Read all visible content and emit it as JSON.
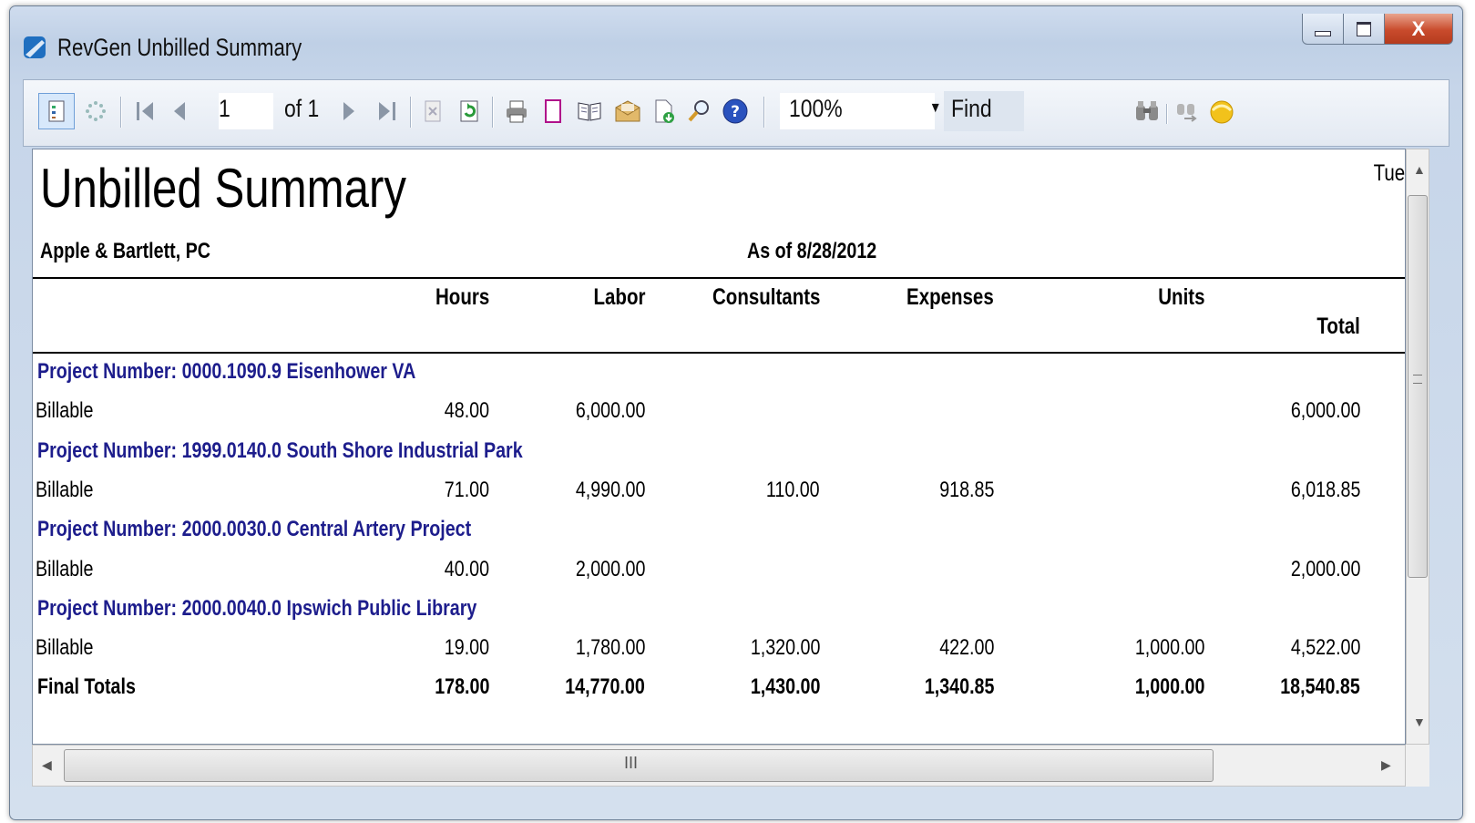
{
  "window": {
    "title": "RevGen Unbilled Summary",
    "controls": {
      "minimize": "minimize",
      "maximize": "maximize",
      "close": "X"
    }
  },
  "toolbar": {
    "page_current": "1",
    "page_of": "of 1",
    "zoom": "100%",
    "find_label": "Find",
    "icons": [
      "document-map-icon",
      "thumbnails-icon",
      "first-page-icon",
      "previous-page-icon",
      "next-page-icon",
      "last-page-icon",
      "stop-icon",
      "refresh-icon",
      "print-icon",
      "page-setup-icon",
      "book-icon",
      "export-icon",
      "save-icon",
      "zoom-icon",
      "help-icon",
      "find-icon",
      "find-next-icon",
      "highlight-icon"
    ]
  },
  "report": {
    "title": "Unbilled Summary",
    "corner_text": "Tue",
    "company": "Apple & Bartlett, PC",
    "as_of": "As of 8/28/2012",
    "columns": [
      "Hours",
      "Labor",
      "Consultants",
      "Expenses",
      "Units",
      "Total"
    ],
    "projects": [
      {
        "header": "Project Number: 0000.1090.9 Eisenhower VA",
        "row_label": "Billable",
        "hours": "48.00",
        "labor": "6,000.00",
        "consultants": "",
        "expenses": "",
        "units": "",
        "total": "6,000.00"
      },
      {
        "header": "Project Number: 1999.0140.0 South Shore Industrial Park",
        "row_label": "Billable",
        "hours": "71.00",
        "labor": "4,990.00",
        "consultants": "110.00",
        "expenses": "918.85",
        "units": "",
        "total": "6,018.85"
      },
      {
        "header": "Project Number: 2000.0030.0 Central Artery Project",
        "row_label": "Billable",
        "hours": "40.00",
        "labor": "2,000.00",
        "consultants": "",
        "expenses": "",
        "units": "",
        "total": "2,000.00"
      },
      {
        "header": "Project Number: 2000.0040.0 Ipswich Public Library",
        "row_label": "Billable",
        "hours": "19.00",
        "labor": "1,780.00",
        "consultants": "1,320.00",
        "expenses": "422.00",
        "units": "1,000.00",
        "total": "4,522.00"
      }
    ],
    "final": {
      "label": "Final Totals",
      "hours": "178.00",
      "labor": "14,770.00",
      "consultants": "1,430.00",
      "expenses": "1,340.85",
      "units": "1,000.00",
      "total": "18,540.85"
    }
  },
  "scrollbar": {
    "h_thumb_grip": "III"
  },
  "colors": {
    "project_header": "#1d1d8c",
    "close_button": "#c94b2c",
    "titlebar": "#c6d5e9"
  }
}
